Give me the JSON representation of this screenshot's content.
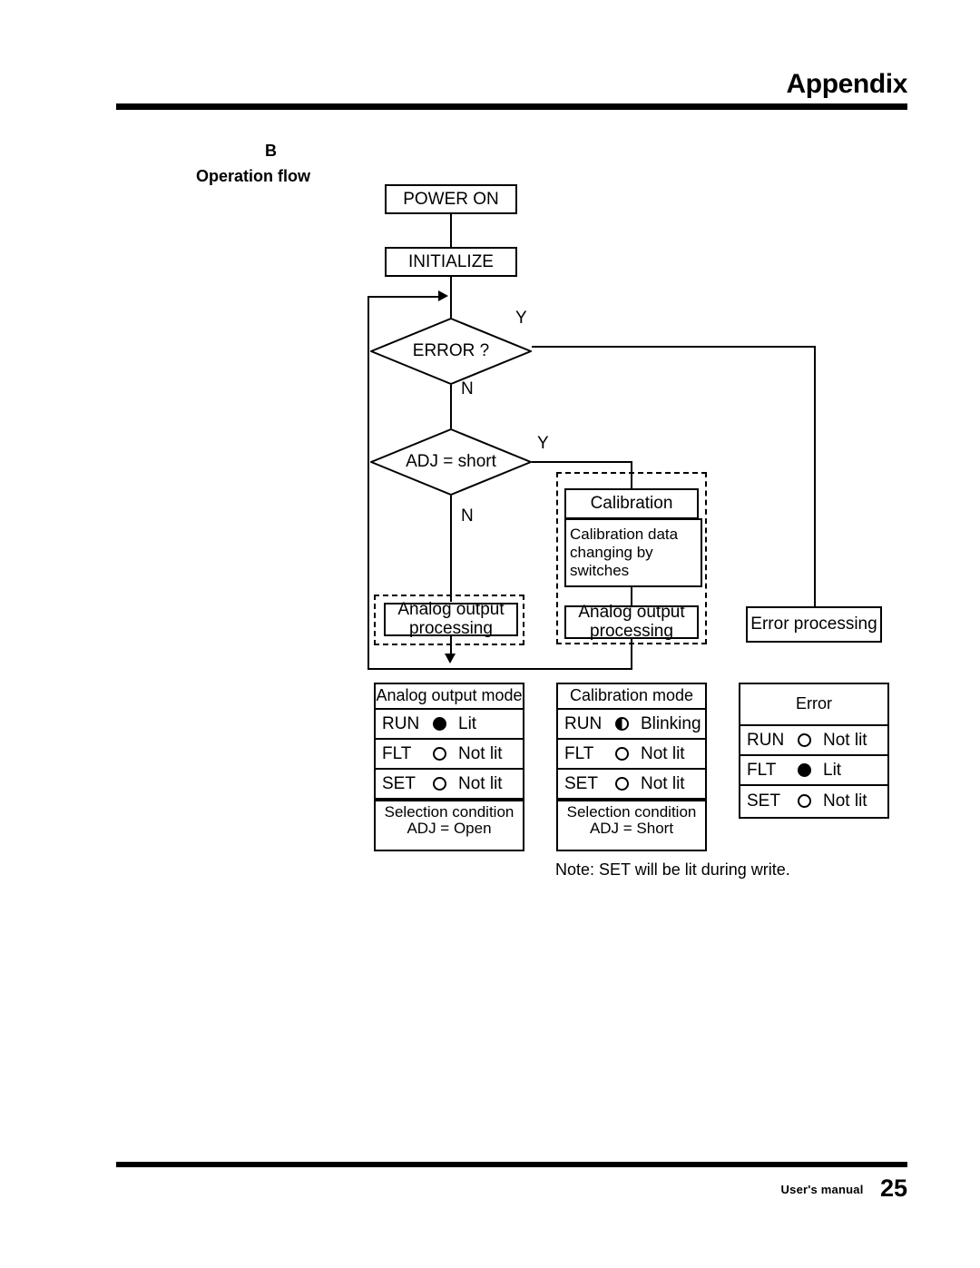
{
  "header": {
    "title": "Appendix"
  },
  "footer": {
    "label": "User's manual",
    "page": "25"
  },
  "section": {
    "letter": "B",
    "title": "Operation flow"
  },
  "flow": {
    "power_on": "POWER ON",
    "initialize": "INITIALIZE",
    "error_q": "ERROR ?",
    "adj_q": "ADJ = short",
    "branch_error_yes": "Y",
    "branch_error_no": "N",
    "branch_adj_yes": "Y",
    "branch_adj_no": "N",
    "calibration_title": "Calibration",
    "calibration_body": "Calibration data changing by switches",
    "analog_left": "Analog output processing",
    "analog_right": "Analog output processing",
    "error_processing": "Error processing"
  },
  "tables": [
    {
      "title": "Analog output mode",
      "rows": [
        {
          "name": "RUN",
          "led": "on",
          "state": "Lit"
        },
        {
          "name": "FLT",
          "led": "off",
          "state": "Not lit"
        },
        {
          "name": "SET",
          "led": "off",
          "state": "Not lit"
        }
      ],
      "footer": "Selection condition ADJ = Open"
    },
    {
      "title": "Calibration mode",
      "rows": [
        {
          "name": "RUN",
          "led": "blink",
          "state": "Blinking"
        },
        {
          "name": "FLT",
          "led": "off",
          "state": "Not lit"
        },
        {
          "name": "SET",
          "led": "off",
          "state": "Not lit"
        }
      ],
      "footer": "Selection condition ADJ = Short"
    },
    {
      "title": "Error",
      "rows": [
        {
          "name": "RUN",
          "led": "off",
          "state": "Not lit"
        },
        {
          "name": "FLT",
          "led": "on",
          "state": "Lit"
        },
        {
          "name": "SET",
          "led": "off",
          "state": "Not lit"
        }
      ],
      "footer": null
    }
  ],
  "note": "Note: SET will be lit during write."
}
